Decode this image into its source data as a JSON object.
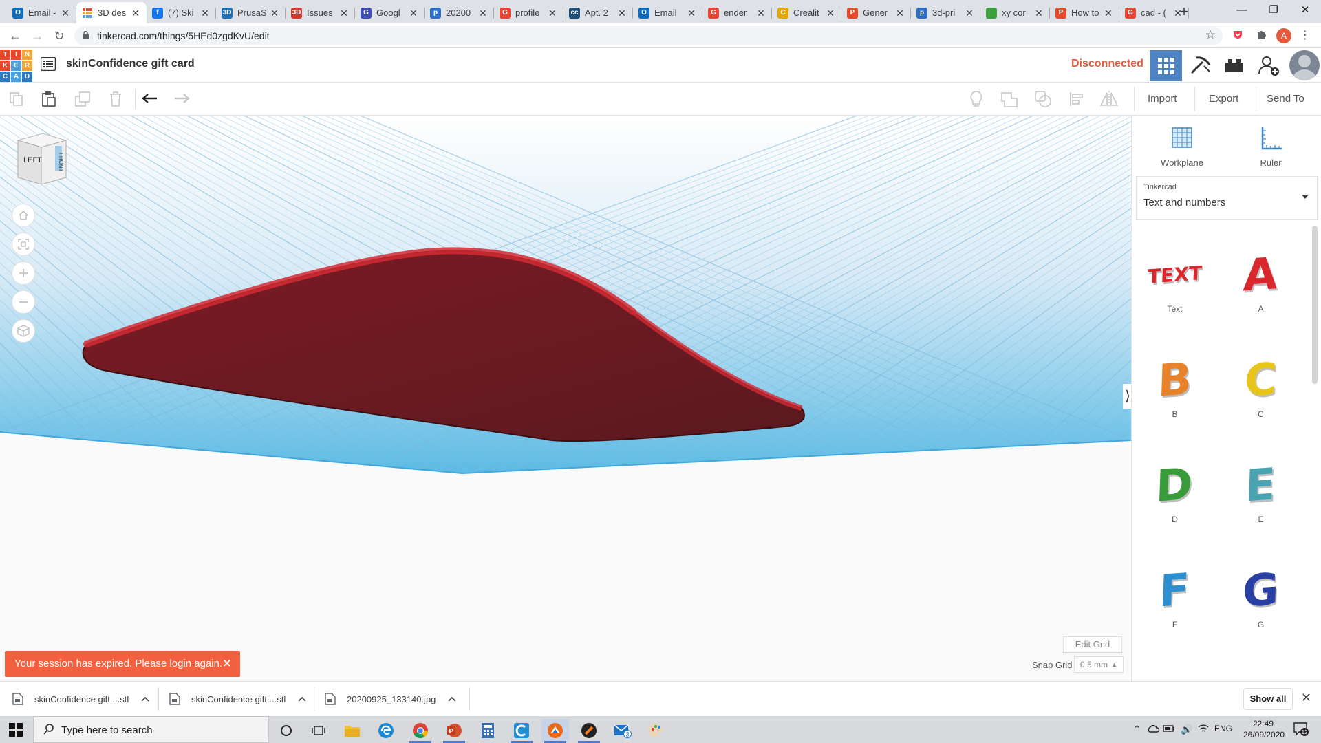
{
  "browser": {
    "tabs": [
      {
        "title": "Email -",
        "icon": "outlook-icon",
        "color": "#0f6cbd",
        "glyph": "O"
      },
      {
        "title": "3D des",
        "icon": "tinkercad-icon",
        "color": "#e9492b",
        "glyph": "",
        "active": true
      },
      {
        "title": "(7) Ski",
        "icon": "facebook-icon",
        "color": "#1877f2",
        "glyph": "f"
      },
      {
        "title": "PrusaS",
        "icon": "thingiverse-icon",
        "color": "#1d6fb8",
        "glyph": "3D"
      },
      {
        "title": "Issues",
        "icon": "3dprint-icon",
        "color": "#d63a2f",
        "glyph": "3D"
      },
      {
        "title": "Googl",
        "icon": "google-drive-icon",
        "color": "#3f51b5",
        "glyph": "G"
      },
      {
        "title": "20200",
        "icon": "p-icon",
        "color": "#2f6ec6",
        "glyph": "p"
      },
      {
        "title": "profile",
        "icon": "google-icon",
        "color": "#ea4335",
        "glyph": "G"
      },
      {
        "title": "Apt. 2",
        "icon": "cc-icon",
        "color": "#1f4e79",
        "glyph": "cc"
      },
      {
        "title": "Email",
        "icon": "outlook-icon",
        "color": "#0f6cbd",
        "glyph": "O"
      },
      {
        "title": "ender",
        "icon": "google-icon",
        "color": "#ea4335",
        "glyph": "G"
      },
      {
        "title": "Crealit",
        "icon": "shop-icon",
        "color": "#e0a800",
        "glyph": "C"
      },
      {
        "title": "Gener",
        "icon": "p-icon",
        "color": "#e9492b",
        "glyph": "P"
      },
      {
        "title": "3d-pri",
        "icon": "p-icon",
        "color": "#2f6ec6",
        "glyph": "p"
      },
      {
        "title": "xy cor",
        "icon": "leaf-icon",
        "color": "#3ca03c",
        "glyph": ""
      },
      {
        "title": "How to",
        "icon": "p-icon",
        "color": "#e9492b",
        "glyph": "P"
      },
      {
        "title": "cad - (",
        "icon": "google-icon",
        "color": "#ea4335",
        "glyph": "G"
      }
    ],
    "url": "tinkercad.com/things/5HEd0zgdKvU/edit",
    "profile_initial": "A"
  },
  "header": {
    "logo_letters": [
      "T",
      "I",
      "N",
      "K",
      "E",
      "R",
      "C",
      "A",
      "D"
    ],
    "logo_colors": [
      "#e9492b",
      "#e9492b",
      "#f2a33a",
      "#e9492b",
      "#4aa3df",
      "#f2a33a",
      "#2f7bc1",
      "#4aa3df",
      "#2f7bc1"
    ],
    "design_title": "skinConfidence gift card",
    "status": "Disconnected"
  },
  "toolbar": {
    "import_label": "Import",
    "export_label": "Export",
    "send_to_label": "Send To"
  },
  "workspace": {
    "viewcube_left": "LEFT",
    "viewcube_front": "FRONT",
    "toast": "Your session has expired. Please login again.",
    "edit_grid": "Edit Grid",
    "snap_grid_label": "Snap Grid",
    "snap_grid_value": "0.5 mm",
    "shape_color": "#8b1a23"
  },
  "panel": {
    "workplane_label": "Workplane",
    "ruler_label": "Ruler",
    "library_caption": "Tinkercad",
    "library_value": "Text and numbers",
    "shapes": [
      {
        "label": "Text",
        "glyph": "TEXT",
        "color": "#d9272e"
      },
      {
        "label": "A",
        "glyph": "A",
        "color": "#d9272e"
      },
      {
        "label": "B",
        "glyph": "B",
        "color": "#e8822a"
      },
      {
        "label": "C",
        "glyph": "C",
        "color": "#e8c51a"
      },
      {
        "label": "D",
        "glyph": "D",
        "color": "#3a9b3a"
      },
      {
        "label": "E",
        "glyph": "E",
        "color": "#4aa3b0"
      },
      {
        "label": "F",
        "glyph": "F",
        "color": "#2e8fd0"
      },
      {
        "label": "G",
        "glyph": "G",
        "color": "#2a3fa3"
      }
    ]
  },
  "downloads": {
    "items": [
      "skinConfidence gift....stl",
      "skinConfidence gift....stl",
      "20200925_133140.jpg"
    ],
    "show_all": "Show all"
  },
  "taskbar": {
    "search_placeholder": "Type here to search",
    "language": "ENG",
    "time": "22:49",
    "date": "26/09/2020",
    "notification_count": "12",
    "mail_badge": "3"
  }
}
